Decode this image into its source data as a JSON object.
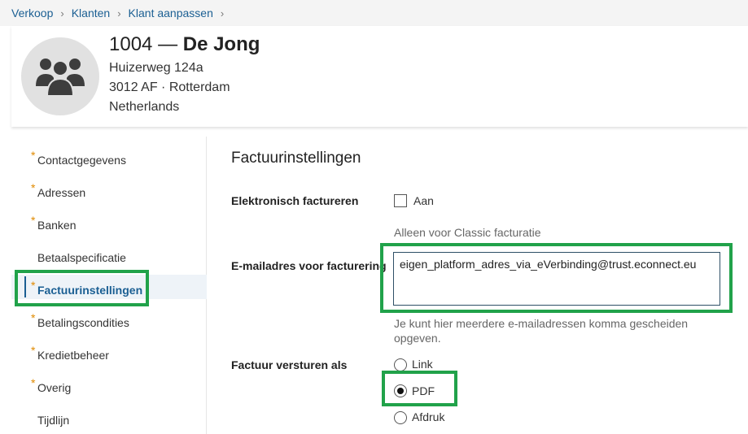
{
  "breadcrumb": [
    "Verkoop",
    "Klanten",
    "Klant aanpassen"
  ],
  "customer": {
    "number": "1004",
    "dash": "—",
    "name": "De Jong",
    "street": "Huizerweg 124a",
    "city": "3012 AF · Rotterdam",
    "country": "Netherlands",
    "avatar_icon": "group-icon"
  },
  "sidebar": {
    "items": [
      {
        "label": "Contactgegevens",
        "required": true
      },
      {
        "label": "Adressen",
        "required": true
      },
      {
        "label": "Banken",
        "required": true
      },
      {
        "label": "Betaalspecificatie",
        "required": false
      },
      {
        "label": "Factuurinstellingen",
        "required": true,
        "active": true
      },
      {
        "label": "Betalingscondities",
        "required": true
      },
      {
        "label": "Kredietbeheer",
        "required": true
      },
      {
        "label": "Overig",
        "required": true
      },
      {
        "label": "Tijdlijn",
        "required": false
      }
    ],
    "required_marker": "*"
  },
  "form": {
    "title": "Factuurinstellingen",
    "einvoice": {
      "label": "Elektronisch factureren",
      "checkbox_label": "Aan",
      "checked": false,
      "hint": "Alleen voor Classic facturatie"
    },
    "email": {
      "label": "E-mailadres voor facturering",
      "value": "eigen_platform_adres_via_eVerbinding@trust.econnect.eu",
      "hint_line1": "Je kunt hier meerdere e-mailadressen komma gescheiden",
      "hint_line2": "opgeven."
    },
    "send_as": {
      "label": "Factuur versturen als",
      "options": [
        "Link",
        "PDF",
        "Afdruk"
      ],
      "selected": "PDF"
    }
  },
  "colors": {
    "link": "#1b5f93",
    "required": "#e08a00",
    "highlight": "#21a24a"
  }
}
